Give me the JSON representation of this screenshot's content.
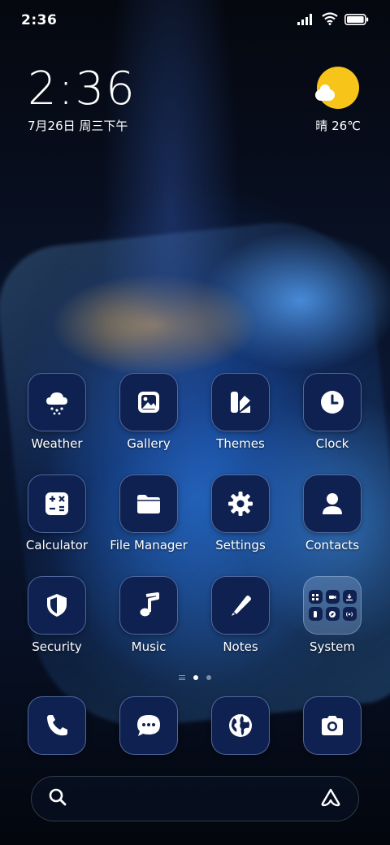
{
  "status_bar": {
    "time": "2:36",
    "icons": [
      "signal-icon",
      "wifi-icon",
      "battery-icon"
    ]
  },
  "clock_widget": {
    "time": "2:36",
    "date": "7月26日 周三下午"
  },
  "weather_widget": {
    "icon": "sunny-cloud-icon",
    "text": "晴 26℃"
  },
  "apps": [
    {
      "label": "Weather",
      "icon": "cloud-rain-icon"
    },
    {
      "label": "Gallery",
      "icon": "image-icon"
    },
    {
      "label": "Themes",
      "icon": "themes-icon"
    },
    {
      "label": "Clock",
      "icon": "clock-icon"
    },
    {
      "label": "Calculator",
      "icon": "calculator-icon"
    },
    {
      "label": "File Manager",
      "icon": "folder-icon"
    },
    {
      "label": "Settings",
      "icon": "gear-icon"
    },
    {
      "label": "Contacts",
      "icon": "person-icon"
    },
    {
      "label": "Security",
      "icon": "shield-icon"
    },
    {
      "label": "Music",
      "icon": "music-note-icon"
    },
    {
      "label": "Notes",
      "icon": "pencil-icon"
    },
    {
      "label": "System",
      "icon": "folder-group-icon"
    }
  ],
  "dock": [
    {
      "icon": "phone-icon"
    },
    {
      "icon": "message-icon"
    },
    {
      "icon": "globe-icon"
    },
    {
      "icon": "camera-icon"
    }
  ],
  "page_indicator": {
    "pages": 2,
    "active": 1
  },
  "search_bar": {
    "left_icon": "search-icon",
    "right_icon": "assistant-icon"
  },
  "colors": {
    "icon_background": "#0f2150",
    "sun": "#f7c51a",
    "text": "#ffffff"
  }
}
